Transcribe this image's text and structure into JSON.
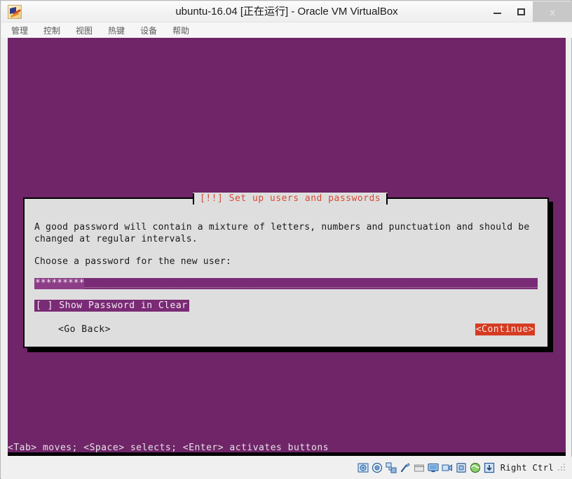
{
  "window": {
    "title": "ubuntu-16.04 [正在运行] - Oracle VM VirtualBox",
    "icon_name": "virtualbox-vm-icon",
    "minimize_label": "",
    "maximize_label": "",
    "close_label": "x"
  },
  "menubar": {
    "items": [
      {
        "label": "管理"
      },
      {
        "label": "控制"
      },
      {
        "label": "视图"
      },
      {
        "label": "热键"
      },
      {
        "label": "设备"
      },
      {
        "label": "帮助"
      }
    ]
  },
  "vm": {
    "background_color": "#6f2568",
    "hint_line": "<Tab> moves; <Space> selects; <Enter> activates buttons",
    "dialog": {
      "title": "[!!] Set up users and passwords",
      "title_color": "#d94a34",
      "paragraph": "A good password will contain a mixture of letters, numbers and punctuation and should be\nchanged at regular intervals.",
      "prompt": "Choose a password for the new user:",
      "password_field": {
        "masked_value": "*********",
        "dashes": "______________________________________________________________________________________________",
        "field_color": "#7a2b75"
      },
      "checkbox": {
        "label": "[ ] Show Password in Clear",
        "checked": false
      },
      "buttons": {
        "back": "<Go Back>",
        "continue": "<Continue>",
        "continue_color": "#d63b22",
        "focused": "continue"
      }
    }
  },
  "statusbar": {
    "icons": [
      {
        "name": "hard-disk-icon"
      },
      {
        "name": "optical-disk-icon"
      },
      {
        "name": "network-icon"
      },
      {
        "name": "usb-icon"
      },
      {
        "name": "shared-folder-icon"
      },
      {
        "name": "display-icon"
      },
      {
        "name": "video-capture-icon"
      },
      {
        "name": "cpu-icon"
      },
      {
        "name": "guest-additions-icon"
      },
      {
        "name": "host-key-icon"
      }
    ],
    "host_key_label": "Right Ctrl"
  }
}
